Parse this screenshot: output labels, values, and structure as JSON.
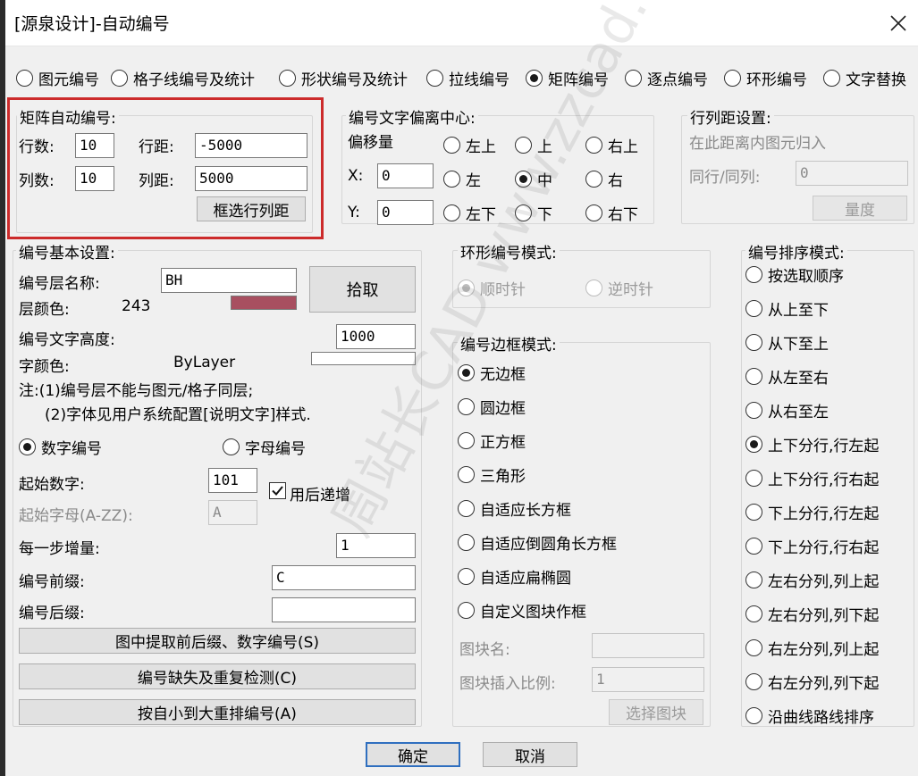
{
  "window": {
    "title": "[源泉设计]-自动编号",
    "close_glyph": "✕"
  },
  "modes": [
    {
      "label": "图元编号",
      "selected": false
    },
    {
      "label": "格子线编号及统计",
      "selected": false
    },
    {
      "label": "形状编号及统计",
      "selected": false
    },
    {
      "label": "拉线编号",
      "selected": false
    },
    {
      "label": "矩阵编号",
      "selected": true
    },
    {
      "label": "逐点编号",
      "selected": false
    },
    {
      "label": "环形编号",
      "selected": false
    },
    {
      "label": "文字替换",
      "selected": false
    }
  ],
  "matrix": {
    "title": "矩阵自动编号:",
    "rows_label": "行数:",
    "rows_value": "10",
    "row_spacing_label": "行距:",
    "row_spacing_value": "-5000",
    "cols_label": "列数:",
    "cols_value": "10",
    "col_spacing_label": "列距:",
    "col_spacing_value": "5000",
    "pick_button": "框选行列距"
  },
  "offset": {
    "title": "编号文字偏离中心:",
    "subtitle": "偏移量",
    "x_label": "X:",
    "x_value": "0",
    "y_label": "Y:",
    "y_value": "0",
    "positions": [
      {
        "label": "左上",
        "selected": false
      },
      {
        "label": "上",
        "selected": false
      },
      {
        "label": "右上",
        "selected": false
      },
      {
        "label": "左",
        "selected": false
      },
      {
        "label": "中",
        "selected": true
      },
      {
        "label": "右",
        "selected": false
      },
      {
        "label": "左下",
        "selected": false
      },
      {
        "label": "下",
        "selected": false
      },
      {
        "label": "右下",
        "selected": false
      }
    ]
  },
  "spacing": {
    "title": "行列距设置:",
    "desc": "在此距离内图元归入",
    "same_label": "同行/同列:",
    "same_value": "0",
    "measure_button": "量度"
  },
  "basic": {
    "title": "编号基本设置:",
    "layer_label": "编号层名称:",
    "layer_value": "BH",
    "layer_color_label": "层颜色:",
    "layer_color_value": "243",
    "layer_swatch": "#a84f60",
    "pick_button": "拾取",
    "text_height_label": "编号文字高度:",
    "text_height_value": "1000",
    "text_color_label": "字颜色:",
    "text_color_value": "ByLayer",
    "note1": "注:(1)编号层不能与图元/格子同层;",
    "note2": "(2)字体见用户系统配置[说明文字]样式.",
    "numeric_label": "数字编号",
    "numeric_selected": true,
    "alpha_label": "字母编号",
    "alpha_selected": false,
    "start_num_label": "起始数字:",
    "start_num_value": "101",
    "increment_after_label": "用后递增",
    "increment_after_checked": true,
    "start_letter_label": "起始字母(A-ZZ):",
    "start_letter_value": "A",
    "step_label": "每一步增量:",
    "step_value": "1",
    "prefix_label": "编号前缀:",
    "prefix_value": "C",
    "suffix_label": "编号后缀:",
    "suffix_value": "",
    "btn_extract": "图中提取前后缀、数字编号(S)",
    "btn_check": "编号缺失及重复检测(C)",
    "btn_renumber": "按自小到大重排编号(A)"
  },
  "ring": {
    "title": "环形编号模式:",
    "cw_label": "顺时针",
    "cw_selected": true,
    "ccw_label": "逆时针",
    "ccw_selected": false
  },
  "border": {
    "title": "编号边框模式:",
    "options": [
      {
        "label": "无边框",
        "selected": true
      },
      {
        "label": "圆边框",
        "selected": false
      },
      {
        "label": "正方框",
        "selected": false
      },
      {
        "label": "三角形",
        "selected": false
      },
      {
        "label": "自适应长方框",
        "selected": false
      },
      {
        "label": "自适应倒圆角长方框",
        "selected": false
      },
      {
        "label": "自适应扁椭圆",
        "selected": false
      },
      {
        "label": "自定义图块作框",
        "selected": false
      }
    ],
    "block_name_label": "图块名:",
    "block_name_value": "",
    "block_scale_label": "图块插入比例:",
    "block_scale_value": "1",
    "select_block_button": "选择图块"
  },
  "sort": {
    "title": "编号排序模式:",
    "options": [
      {
        "label": "按选取顺序",
        "selected": false
      },
      {
        "label": "从上至下",
        "selected": false
      },
      {
        "label": "从下至上",
        "selected": false
      },
      {
        "label": "从左至右",
        "selected": false
      },
      {
        "label": "从右至左",
        "selected": false
      },
      {
        "label": "上下分行,行左起",
        "selected": true
      },
      {
        "label": "上下分行,行右起",
        "selected": false
      },
      {
        "label": "下上分行,行左起",
        "selected": false
      },
      {
        "label": "下上分行,行右起",
        "selected": false
      },
      {
        "label": "左右分列,列上起",
        "selected": false
      },
      {
        "label": "左右分列,列下起",
        "selected": false
      },
      {
        "label": "右左分列,列上起",
        "selected": false
      },
      {
        "label": "右左分列,列下起",
        "selected": false
      },
      {
        "label": "沿曲线路线排序",
        "selected": false
      }
    ]
  },
  "footer": {
    "ok": "确定",
    "cancel": "取消"
  },
  "watermark": "周站长CAD www.zzcad.com"
}
